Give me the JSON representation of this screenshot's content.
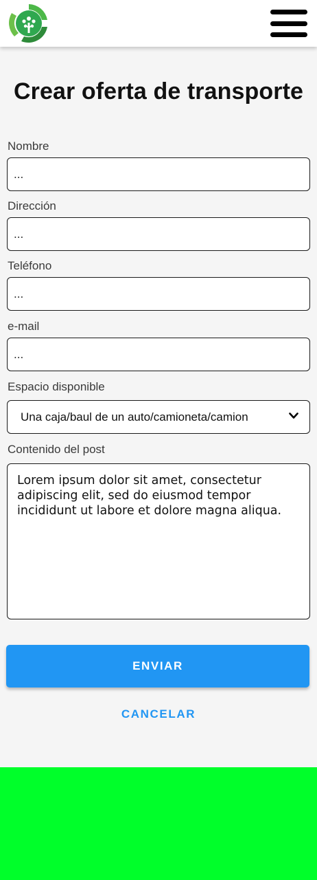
{
  "header": {
    "logo_icon": "recycle-tree-logo",
    "menu_icon": "hamburger-menu-icon"
  },
  "page": {
    "title": "Crear oferta de transporte"
  },
  "form": {
    "nombre": {
      "label": "Nombre",
      "placeholder": "..."
    },
    "direccion": {
      "label": "Dirección",
      "placeholder": "..."
    },
    "telefono": {
      "label": "Teléfono",
      "placeholder": "..."
    },
    "email": {
      "label": "e-mail",
      "placeholder": "..."
    },
    "espacio": {
      "label": "Espacio disponible",
      "selected": "Una caja/baul de un auto/camioneta/camion",
      "icon": "chevron-down-icon"
    },
    "contenido": {
      "label": "Contenido del post",
      "value": "Lorem ipsum dolor sit amet, consectetur adipiscing elit, sed do eiusmod tempor incididunt ut labore et dolore magna aliqua."
    }
  },
  "actions": {
    "submit_label": "ENVIAR",
    "cancel_label": "CANCELAR"
  },
  "colors": {
    "accent": "#2196f3",
    "footer": "#00ff2a",
    "logo_green": "#2fa84f"
  }
}
